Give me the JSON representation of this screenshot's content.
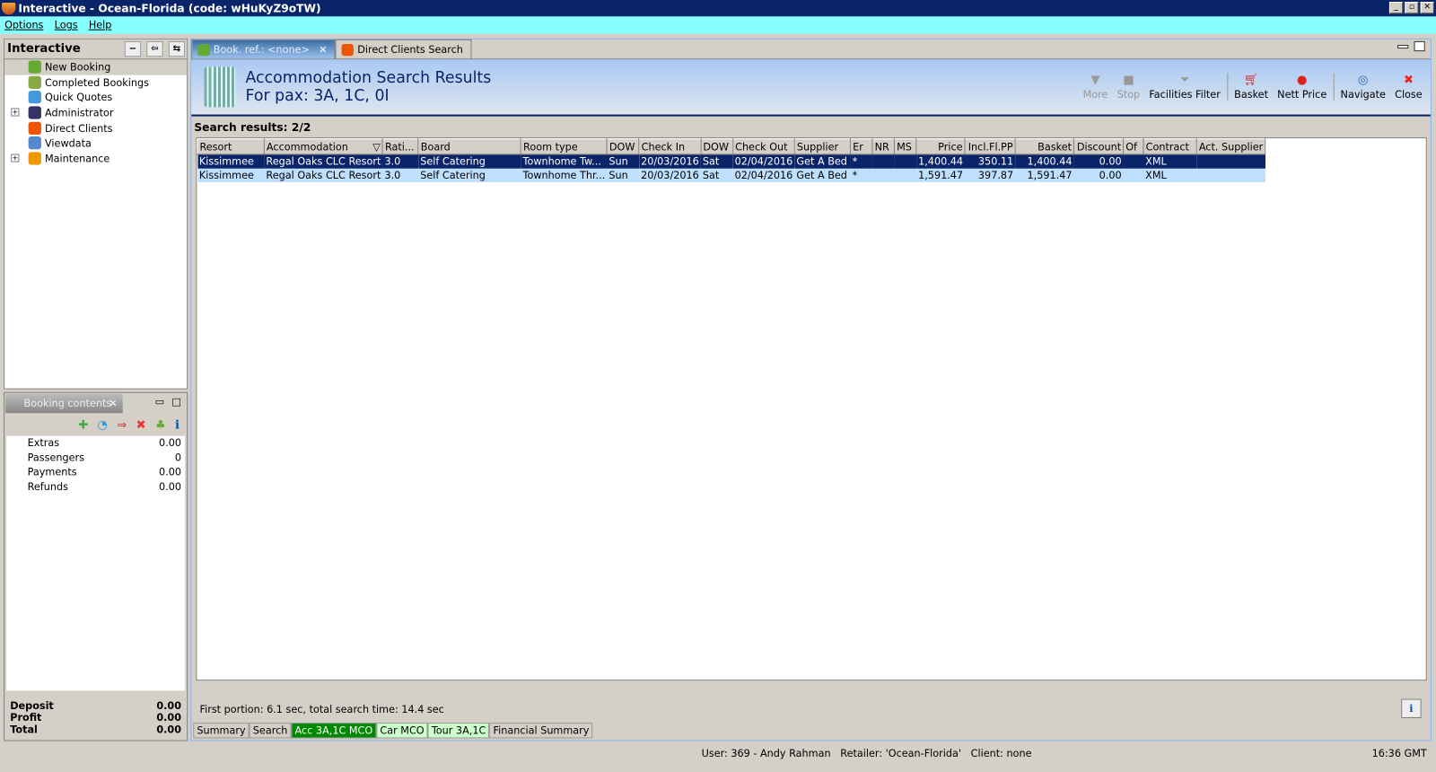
{
  "window": {
    "title": "Interactive - Ocean-Florida (code: wHuKyZ9oTW)"
  },
  "menu": [
    "Options",
    "Logs",
    "Help"
  ],
  "nav": {
    "title": "Interactive",
    "items": [
      {
        "label": "New Booking",
        "icon": "palm-tree-icon",
        "color": "#6a3"
      },
      {
        "label": "Completed Bookings",
        "icon": "palm-money-icon",
        "color": "#8a4"
      },
      {
        "label": "Quick Quotes",
        "icon": "clock-icon",
        "color": "#49d"
      },
      {
        "label": "Administrator",
        "icon": "runner-icon",
        "color": "#336"
      },
      {
        "label": "Direct Clients",
        "icon": "person-icon",
        "color": "#e50"
      },
      {
        "label": "Viewdata",
        "icon": "globe-icon",
        "color": "#58c"
      },
      {
        "label": "Maintenance",
        "icon": "books-icon",
        "color": "#e90"
      }
    ]
  },
  "booking": {
    "tab": "Booking contents",
    "rows": [
      {
        "label": "Extras",
        "value": "0.00"
      },
      {
        "label": "Passengers",
        "value": "0"
      },
      {
        "label": "Payments",
        "value": "0.00"
      },
      {
        "label": "Refunds",
        "value": "0.00"
      }
    ],
    "totals": [
      {
        "label": "Deposit",
        "value": "0.00"
      },
      {
        "label": "Profit",
        "value": "0.00"
      },
      {
        "label": "Total",
        "value": "0.00"
      }
    ]
  },
  "tabs": [
    "Book. ref.: <none>",
    "Direct Clients Search"
  ],
  "header": {
    "title": "Accommodation Search Results",
    "subtitle": "For pax: 3A, 1C, 0I"
  },
  "toolbar": {
    "more": "More",
    "stop": "Stop",
    "facilities": "Facilities Filter",
    "basket": "Basket",
    "nett": "Nett Price",
    "navigate": "Navigate",
    "close": "Close"
  },
  "results_label": "Search results: 2/2",
  "table": {
    "columns": [
      "Resort",
      "Accommodation",
      "Rati...",
      "Board",
      "Room type",
      "DOW",
      "Check In",
      "DOW",
      "Check Out",
      "Supplier",
      "Er",
      "NR",
      "MS",
      "Price",
      "Incl.Fl.PP",
      "Basket",
      "Discount",
      "Of",
      "Contract",
      "Act. Supplier"
    ],
    "rows": [
      [
        "Kissimmee",
        "Regal Oaks CLC Resort",
        "3.0",
        "Self Catering",
        "Townhome Tw...",
        "Sun",
        "20/03/2016",
        "Sat",
        "02/04/2016",
        "Get A Bed",
        "*",
        "",
        "",
        "1,400.44",
        "350.11",
        "1,400.44",
        "0.00",
        "",
        "XML",
        ""
      ],
      [
        "Kissimmee",
        "Regal Oaks CLC Resort",
        "3.0",
        "Self Catering",
        "Townhome Thr...",
        "Sun",
        "20/03/2016",
        "Sat",
        "02/04/2016",
        "Get A Bed",
        "*",
        "",
        "",
        "1,591.47",
        "397.87",
        "1,591.47",
        "0.00",
        "",
        "XML",
        ""
      ]
    ]
  },
  "footer": "First portion: 6.1 sec, total search time: 14.4 sec",
  "bottom_tabs": [
    "Summary",
    "Search",
    "Acc 3A,1C MCO",
    "Car MCO",
    "Tour 3A,1C",
    "Financial Summary"
  ],
  "status": {
    "user": "User: 369 - Andy Rahman   Retailer: 'Ocean-Florida'   Client: none",
    "time": "16:36 GMT"
  }
}
